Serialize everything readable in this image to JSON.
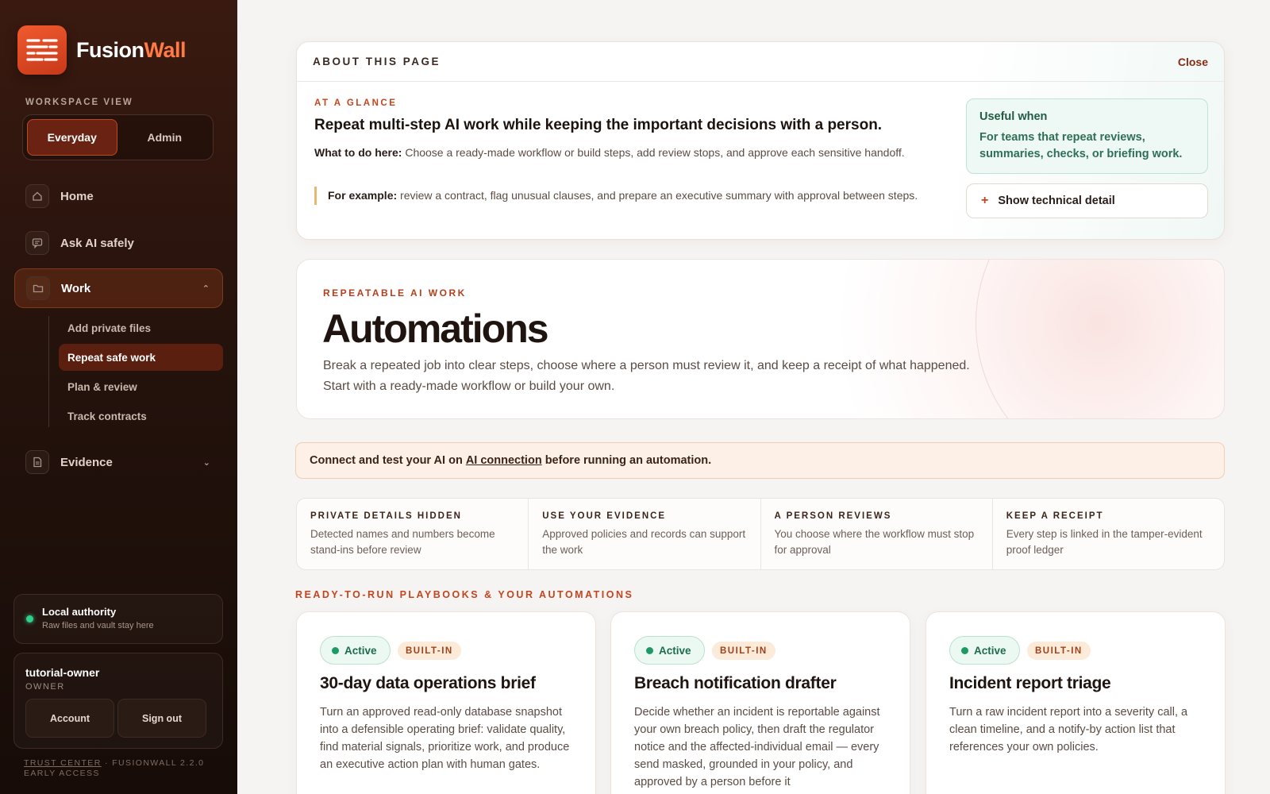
{
  "brand": {
    "name_part1": "Fusion",
    "name_part2": "Wall"
  },
  "workspace": {
    "label": "WORKSPACE VIEW",
    "options": [
      "Everyday",
      "Admin"
    ],
    "selected": "Everyday"
  },
  "nav": {
    "home": "Home",
    "ask": "Ask AI safely",
    "work": "Work",
    "work_sub": [
      "Add private files",
      "Repeat safe work",
      "Plan & review",
      "Track contracts"
    ],
    "evidence": "Evidence"
  },
  "authority": {
    "title": "Local authority",
    "subtitle": "Raw files and vault stay here"
  },
  "user": {
    "name": "tutorial-owner",
    "role": "OWNER",
    "account_label": "Account",
    "signout_label": "Sign out"
  },
  "footer": {
    "trust_center": "TRUST CENTER",
    "version": "· FUSIONWALL 2.2.0",
    "stage": "EARLY ACCESS"
  },
  "about": {
    "title": "ABOUT THIS PAGE",
    "close_label": "Close",
    "glance_label": "AT A GLANCE",
    "glance_title": "Repeat multi-step AI work while keeping the important decisions with a person.",
    "what_label": "What to do here:",
    "what_text": "Choose a ready-made workflow or build steps, add review stops, and approve each sensitive handoff.",
    "example_label": "For example:",
    "example_text": "review a contract, flag unusual clauses, and prepare an executive summary with approval between steps.",
    "useful_title": "Useful when",
    "useful_text": "For teams that repeat reviews, summaries, checks, or briefing work.",
    "tech_label": "Show technical detail"
  },
  "hero": {
    "label": "REPEATABLE AI WORK",
    "title": "Automations",
    "description_line1": "Break a repeated job into clear steps, choose where a person must review it, and keep a receipt of what happened.",
    "description_line2": "Start with a ready-made workflow or build your own."
  },
  "notice": {
    "prefix": "Connect and test your AI on",
    "link": "AI connection",
    "suffix": "before running an automation."
  },
  "features": [
    {
      "title": "PRIVATE DETAILS HIDDEN",
      "desc": "Detected names and numbers become stand-ins before review"
    },
    {
      "title": "USE YOUR EVIDENCE",
      "desc": "Approved policies and records can support the work"
    },
    {
      "title": "A PERSON REVIEWS",
      "desc": "You choose where the workflow must stop for approval"
    },
    {
      "title": "KEEP A RECEIPT",
      "desc": "Every step is linked in the tamper-evident proof ledger"
    }
  ],
  "section_title": "READY-TO-RUN PLAYBOOKS & YOUR AUTOMATIONS",
  "cards": [
    {
      "status": "Active",
      "tag": "BUILT-IN",
      "title": "30-day data operations brief",
      "desc": "Turn an approved read-only database snapshot into a defensible operating brief: validate quality, find material signals, prioritize work, and produce an executive action plan with human gates."
    },
    {
      "status": "Active",
      "tag": "BUILT-IN",
      "title": "Breach notification drafter",
      "desc": "Decide whether an incident is reportable against your own breach policy, then draft the regulator notice and the affected-individual email — every send masked, grounded in your policy, and approved by a person before it"
    },
    {
      "status": "Active",
      "tag": "BUILT-IN",
      "title": "Incident report triage",
      "desc": "Turn a raw incident report into a severity call, a clean timeline, and a notify-by action list that references your own policies."
    }
  ],
  "colors": {
    "accent": "#c2451f",
    "sidebar_bg": "#24120c",
    "active_green": "#1d9a64"
  }
}
